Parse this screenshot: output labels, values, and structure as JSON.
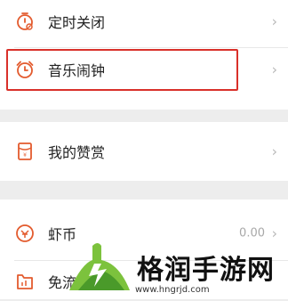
{
  "accent_color": "#e35b2e",
  "menu": {
    "sleep_timer": {
      "label": "定时关闭",
      "icon": "timer-off-icon"
    },
    "music_alarm": {
      "label": "音乐闹钟",
      "icon": "alarm-clock-icon"
    },
    "my_tips": {
      "label": "我的赞赏",
      "icon": "red-envelope-icon"
    },
    "shrimp_coin": {
      "label": "虾币",
      "value": "0.00",
      "icon": "coin-icon"
    },
    "free_traffic": {
      "label": "免流",
      "icon": "free-data-icon"
    }
  },
  "watermark": {
    "title": "格润手游网",
    "url": "www.hngrjd.com"
  }
}
